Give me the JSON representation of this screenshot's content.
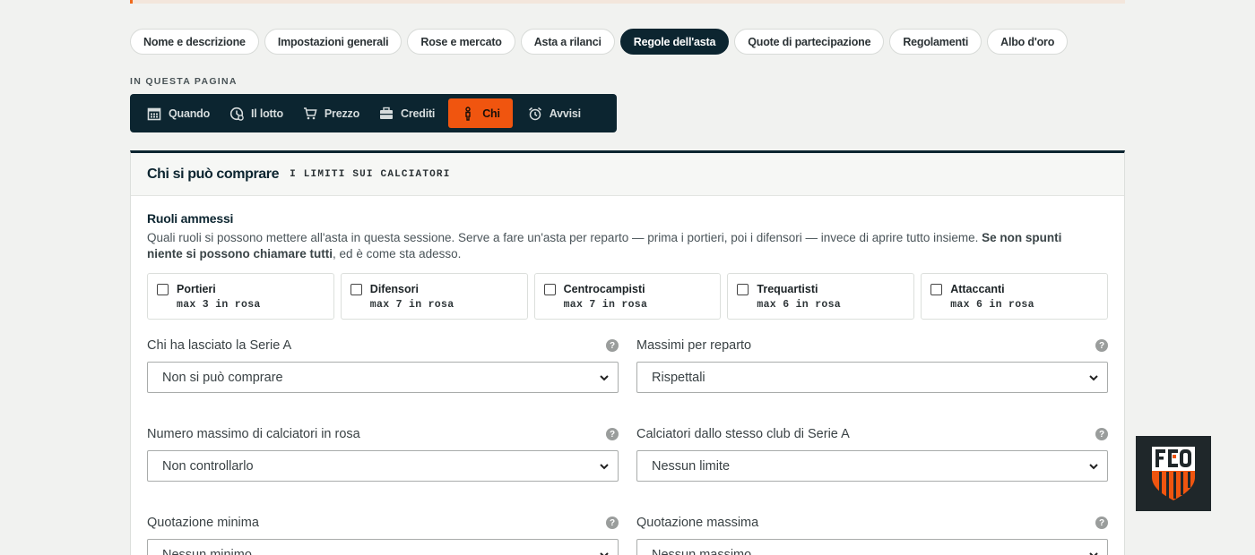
{
  "tabs": [
    {
      "label": "Nome e descrizione"
    },
    {
      "label": "Impostazioni generali"
    },
    {
      "label": "Rose e mercato"
    },
    {
      "label": "Asta a rilanci"
    },
    {
      "label": "Regole dell'asta"
    },
    {
      "label": "Quote di partecipazione"
    },
    {
      "label": "Regolamenti"
    },
    {
      "label": "Albo d'oro"
    }
  ],
  "active_tab": "Regole dell'asta",
  "in_page_label": "IN QUESTA PAGINA",
  "subnav": [
    {
      "label": "Quando",
      "icon": "calendar-icon"
    },
    {
      "label": "Il lotto",
      "icon": "clock-icon"
    },
    {
      "label": "Prezzo",
      "icon": "cart-icon"
    },
    {
      "label": "Crediti",
      "icon": "wallet-icon"
    },
    {
      "label": "Chi",
      "icon": "person-icon"
    },
    {
      "label": "Avvisi",
      "icon": "alarm-icon"
    }
  ],
  "active_subnav": "Chi",
  "colors": {
    "navy": "#0c2530",
    "accent": "#f0550f"
  },
  "card": {
    "title": "Chi si può comprare",
    "subtitle": "I LIMITI SUI CALCIATORI"
  },
  "roles_section": {
    "title": "Ruoli ammessi",
    "desc_plain": "Quali ruoli si possono mettere all'asta in questa sessione. Serve a fare un'asta per reparto — prima i portieri, poi i difensori — invece di aprire tutto insieme.",
    "desc_bold": "Se non spunti niente si possono chiamare tutti",
    "desc_tail": ", ed è come sta adesso.",
    "roles": [
      {
        "name": "Portieri",
        "max": "max 3 in rosa",
        "checked": false
      },
      {
        "name": "Difensori",
        "max": "max 7 in rosa",
        "checked": false
      },
      {
        "name": "Centrocampisti",
        "max": "max 7 in rosa",
        "checked": false
      },
      {
        "name": "Trequartisti",
        "max": "max 6 in rosa",
        "checked": false
      },
      {
        "name": "Attaccanti",
        "max": "max 6 in rosa",
        "checked": false
      }
    ]
  },
  "fields": [
    {
      "label": "Chi ha lasciato la Serie A",
      "value": "Non si può comprare"
    },
    {
      "label": "Massimi per reparto",
      "value": "Rispettali"
    },
    {
      "label": "Numero massimo di calciatori in rosa",
      "value": "Non controllarlo"
    },
    {
      "label": "Calciatori dallo stesso club di Serie A",
      "value": "Nessun limite"
    },
    {
      "label": "Quotazione minima",
      "value": "Nessun minimo"
    },
    {
      "label": "Quotazione massima",
      "value": "Nessun massimo"
    }
  ],
  "help_glyph": "?",
  "logo_text": "FCO"
}
